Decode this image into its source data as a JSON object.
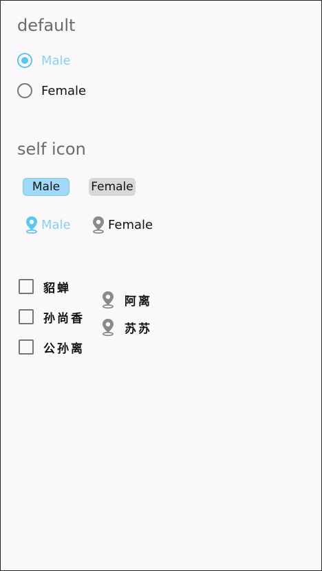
{
  "default_section": {
    "title": "default",
    "options": [
      {
        "label": "Male",
        "checked": true
      },
      {
        "label": "Female",
        "checked": false
      }
    ]
  },
  "self_icon_section": {
    "title": "self icon",
    "pills": [
      {
        "label": "Male",
        "selected": true
      },
      {
        "label": "Female",
        "selected": false
      }
    ],
    "pin_options": [
      {
        "label": "Male",
        "icon": "location-pin-icon",
        "selected": true
      },
      {
        "label": "Female",
        "icon": "location-pin-icon",
        "selected": false
      }
    ]
  },
  "checkbox_group": {
    "items": [
      {
        "label": "貂蝉",
        "checked": false
      },
      {
        "label": "孙尚香",
        "checked": false
      },
      {
        "label": "公孙离",
        "checked": false
      }
    ]
  },
  "pin_group": {
    "items": [
      {
        "label": "阿离",
        "icon": "location-pin-icon"
      },
      {
        "label": "苏苏",
        "icon": "location-pin-icon"
      }
    ]
  },
  "colors": {
    "accent": "#5ac8f5",
    "accent_light": "#8ad0f2",
    "pill_selected": "#9fdaf8",
    "pill_unselected": "#d8d7da",
    "pin_inactive": "#8a8a8a"
  }
}
